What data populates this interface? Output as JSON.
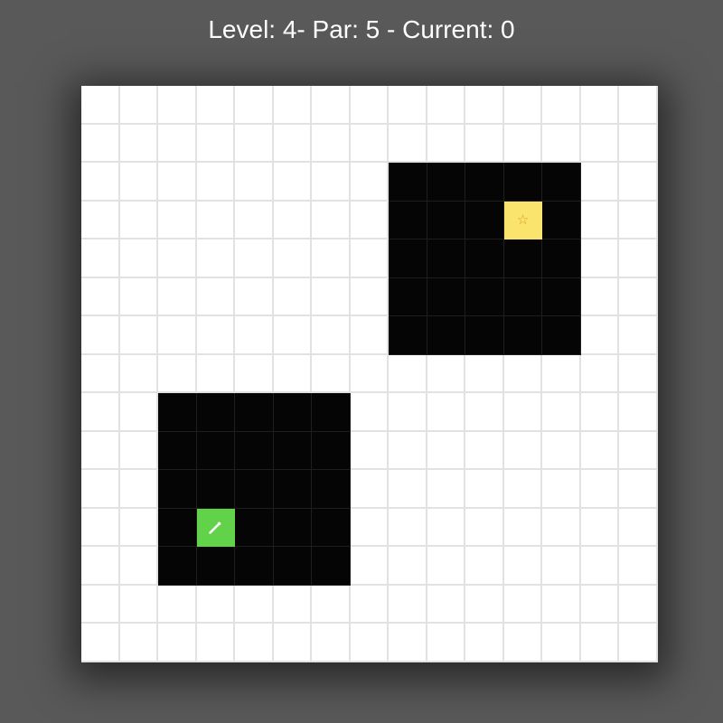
{
  "header": {
    "status_text": "Level: 4- Par: 5 - Current: 0"
  },
  "board": {
    "cols": 15,
    "rows": 15,
    "dark_regions": [
      {
        "col": 8,
        "row": 2,
        "cols": 5,
        "rows": 5
      },
      {
        "col": 2,
        "row": 8,
        "cols": 5,
        "rows": 5
      }
    ],
    "goal": {
      "col": 11,
      "row": 3,
      "icon": "star-icon",
      "symbol": "☆"
    },
    "player": {
      "col": 3,
      "row": 11,
      "icon": "wand-icon"
    }
  },
  "colors": {
    "background": "#595959",
    "board_light": "#ffffff",
    "grid_line": "#e2e2e2",
    "dark_cell": "#050505",
    "goal": "#fbe46e",
    "goal_star": "#e39a1f",
    "player": "#62d24a"
  }
}
